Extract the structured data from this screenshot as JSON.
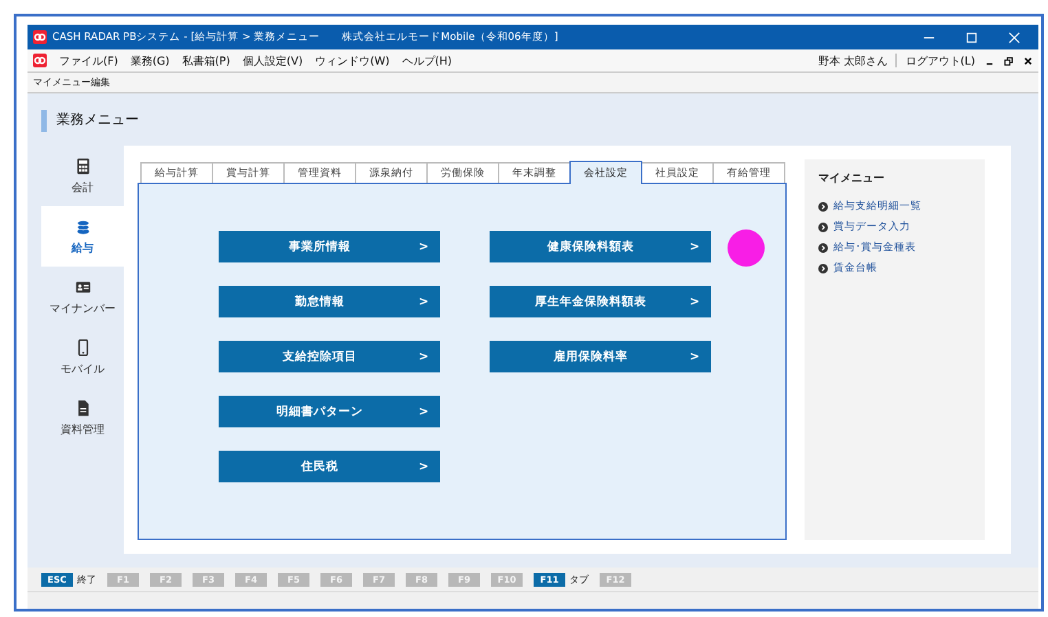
{
  "window": {
    "title": "CASH RADAR PBシステム - [給与計算 > 業務メニュー　　株式会社エルモードMobile（令和06年度）]"
  },
  "menu": [
    "ファイル(F)",
    "業務(G)",
    "私書箱(P)",
    "個人設定(V)",
    "ウィンドウ(W)",
    "ヘルプ(H)"
  ],
  "user": {
    "name": "野本 太郎さん",
    "logout": "ログアウト(L)"
  },
  "toolbar": {
    "label": "マイメニュー編集"
  },
  "heading": "業務メニュー",
  "sidebar": {
    "items": [
      {
        "label": "会計",
        "kind": "calculator",
        "selected": false
      },
      {
        "label": "給与",
        "kind": "coins",
        "selected": true
      },
      {
        "label": "マイナンバー",
        "kind": "card",
        "selected": false
      },
      {
        "label": "モバイル",
        "kind": "phone",
        "selected": false
      },
      {
        "label": "資料管理",
        "kind": "document",
        "selected": false
      }
    ]
  },
  "tabs": [
    {
      "label": "給与計算",
      "selected": false
    },
    {
      "label": "賞与計算",
      "selected": false
    },
    {
      "label": "管理資料",
      "selected": false
    },
    {
      "label": "源泉納付",
      "selected": false
    },
    {
      "label": "労働保険",
      "selected": false
    },
    {
      "label": "年末調整",
      "selected": false
    },
    {
      "label": "会社設定",
      "selected": true
    },
    {
      "label": "社員設定",
      "selected": false
    },
    {
      "label": "有給管理",
      "selected": false
    }
  ],
  "columns": [
    {
      "buttons": [
        {
          "label": "事業所情報",
          "arrow": ">"
        },
        {
          "label": "勤怠情報",
          "arrow": ">"
        },
        {
          "label": "支給控除項目",
          "arrow": ">"
        },
        {
          "label": "明細書パターン",
          "arrow": ">"
        },
        {
          "label": "住民税",
          "arrow": ">"
        }
      ]
    },
    {
      "buttons": [
        {
          "label": "健康保険料額表",
          "arrow": ">"
        },
        {
          "label": "厚生年金保険料額表",
          "arrow": ">"
        },
        {
          "label": "雇用保険料率",
          "arrow": ">"
        }
      ]
    }
  ],
  "my_menu": {
    "title": "マイメニュー",
    "items": [
      "給与支給明細一覧",
      "賞与データ入力",
      "給与･賞与金種表",
      "賃金台帳"
    ]
  },
  "function_keys": [
    {
      "key": "ESC",
      "enabled": true,
      "label": "終了"
    },
    {
      "key": "F1",
      "enabled": false
    },
    {
      "key": "F2",
      "enabled": false
    },
    {
      "key": "F3",
      "enabled": false
    },
    {
      "key": "F4",
      "enabled": false
    },
    {
      "key": "F5",
      "enabled": false
    },
    {
      "key": "F6",
      "enabled": false
    },
    {
      "key": "F7",
      "enabled": false
    },
    {
      "key": "F8",
      "enabled": false
    },
    {
      "key": "F9",
      "enabled": false
    },
    {
      "key": "F10",
      "enabled": false
    },
    {
      "key": "F11",
      "enabled": true,
      "label": "タブ"
    },
    {
      "key": "F12",
      "enabled": false
    }
  ]
}
